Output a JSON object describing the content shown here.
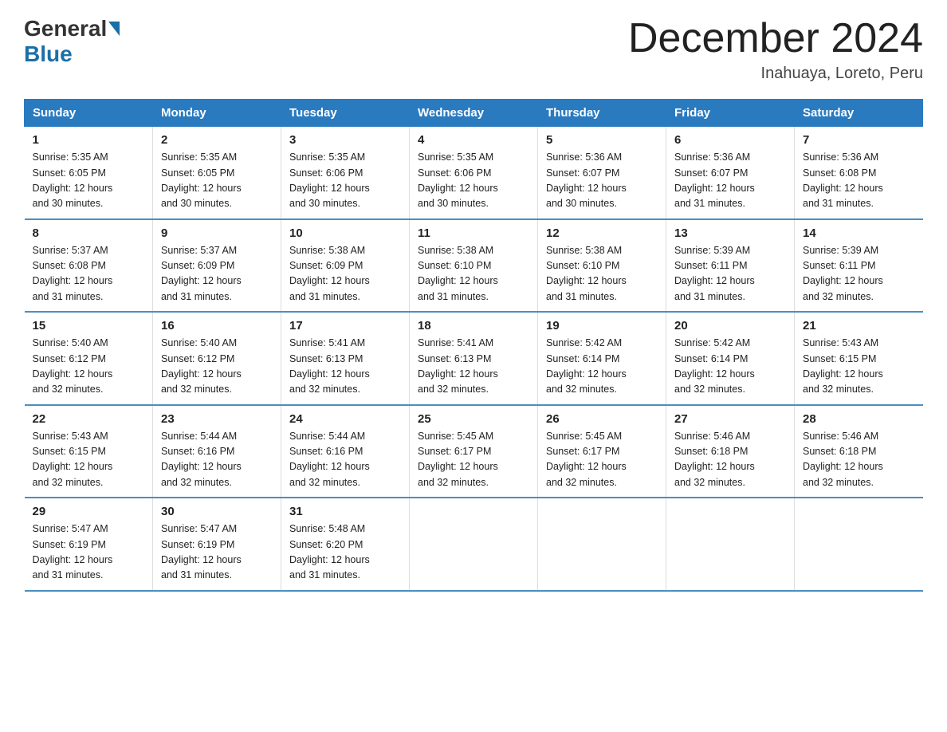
{
  "header": {
    "logo_general": "General",
    "logo_blue": "Blue",
    "month_title": "December 2024",
    "location": "Inahuaya, Loreto, Peru"
  },
  "weekdays": [
    "Sunday",
    "Monday",
    "Tuesday",
    "Wednesday",
    "Thursday",
    "Friday",
    "Saturday"
  ],
  "weeks": [
    [
      {
        "day": "1",
        "sunrise": "5:35 AM",
        "sunset": "6:05 PM",
        "daylight": "12 hours and 30 minutes."
      },
      {
        "day": "2",
        "sunrise": "5:35 AM",
        "sunset": "6:05 PM",
        "daylight": "12 hours and 30 minutes."
      },
      {
        "day": "3",
        "sunrise": "5:35 AM",
        "sunset": "6:06 PM",
        "daylight": "12 hours and 30 minutes."
      },
      {
        "day": "4",
        "sunrise": "5:35 AM",
        "sunset": "6:06 PM",
        "daylight": "12 hours and 30 minutes."
      },
      {
        "day": "5",
        "sunrise": "5:36 AM",
        "sunset": "6:07 PM",
        "daylight": "12 hours and 30 minutes."
      },
      {
        "day": "6",
        "sunrise": "5:36 AM",
        "sunset": "6:07 PM",
        "daylight": "12 hours and 31 minutes."
      },
      {
        "day": "7",
        "sunrise": "5:36 AM",
        "sunset": "6:08 PM",
        "daylight": "12 hours and 31 minutes."
      }
    ],
    [
      {
        "day": "8",
        "sunrise": "5:37 AM",
        "sunset": "6:08 PM",
        "daylight": "12 hours and 31 minutes."
      },
      {
        "day": "9",
        "sunrise": "5:37 AM",
        "sunset": "6:09 PM",
        "daylight": "12 hours and 31 minutes."
      },
      {
        "day": "10",
        "sunrise": "5:38 AM",
        "sunset": "6:09 PM",
        "daylight": "12 hours and 31 minutes."
      },
      {
        "day": "11",
        "sunrise": "5:38 AM",
        "sunset": "6:10 PM",
        "daylight": "12 hours and 31 minutes."
      },
      {
        "day": "12",
        "sunrise": "5:38 AM",
        "sunset": "6:10 PM",
        "daylight": "12 hours and 31 minutes."
      },
      {
        "day": "13",
        "sunrise": "5:39 AM",
        "sunset": "6:11 PM",
        "daylight": "12 hours and 31 minutes."
      },
      {
        "day": "14",
        "sunrise": "5:39 AM",
        "sunset": "6:11 PM",
        "daylight": "12 hours and 32 minutes."
      }
    ],
    [
      {
        "day": "15",
        "sunrise": "5:40 AM",
        "sunset": "6:12 PM",
        "daylight": "12 hours and 32 minutes."
      },
      {
        "day": "16",
        "sunrise": "5:40 AM",
        "sunset": "6:12 PM",
        "daylight": "12 hours and 32 minutes."
      },
      {
        "day": "17",
        "sunrise": "5:41 AM",
        "sunset": "6:13 PM",
        "daylight": "12 hours and 32 minutes."
      },
      {
        "day": "18",
        "sunrise": "5:41 AM",
        "sunset": "6:13 PM",
        "daylight": "12 hours and 32 minutes."
      },
      {
        "day": "19",
        "sunrise": "5:42 AM",
        "sunset": "6:14 PM",
        "daylight": "12 hours and 32 minutes."
      },
      {
        "day": "20",
        "sunrise": "5:42 AM",
        "sunset": "6:14 PM",
        "daylight": "12 hours and 32 minutes."
      },
      {
        "day": "21",
        "sunrise": "5:43 AM",
        "sunset": "6:15 PM",
        "daylight": "12 hours and 32 minutes."
      }
    ],
    [
      {
        "day": "22",
        "sunrise": "5:43 AM",
        "sunset": "6:15 PM",
        "daylight": "12 hours and 32 minutes."
      },
      {
        "day": "23",
        "sunrise": "5:44 AM",
        "sunset": "6:16 PM",
        "daylight": "12 hours and 32 minutes."
      },
      {
        "day": "24",
        "sunrise": "5:44 AM",
        "sunset": "6:16 PM",
        "daylight": "12 hours and 32 minutes."
      },
      {
        "day": "25",
        "sunrise": "5:45 AM",
        "sunset": "6:17 PM",
        "daylight": "12 hours and 32 minutes."
      },
      {
        "day": "26",
        "sunrise": "5:45 AM",
        "sunset": "6:17 PM",
        "daylight": "12 hours and 32 minutes."
      },
      {
        "day": "27",
        "sunrise": "5:46 AM",
        "sunset": "6:18 PM",
        "daylight": "12 hours and 32 minutes."
      },
      {
        "day": "28",
        "sunrise": "5:46 AM",
        "sunset": "6:18 PM",
        "daylight": "12 hours and 32 minutes."
      }
    ],
    [
      {
        "day": "29",
        "sunrise": "5:47 AM",
        "sunset": "6:19 PM",
        "daylight": "12 hours and 31 minutes."
      },
      {
        "day": "30",
        "sunrise": "5:47 AM",
        "sunset": "6:19 PM",
        "daylight": "12 hours and 31 minutes."
      },
      {
        "day": "31",
        "sunrise": "5:48 AM",
        "sunset": "6:20 PM",
        "daylight": "12 hours and 31 minutes."
      },
      null,
      null,
      null,
      null
    ]
  ]
}
